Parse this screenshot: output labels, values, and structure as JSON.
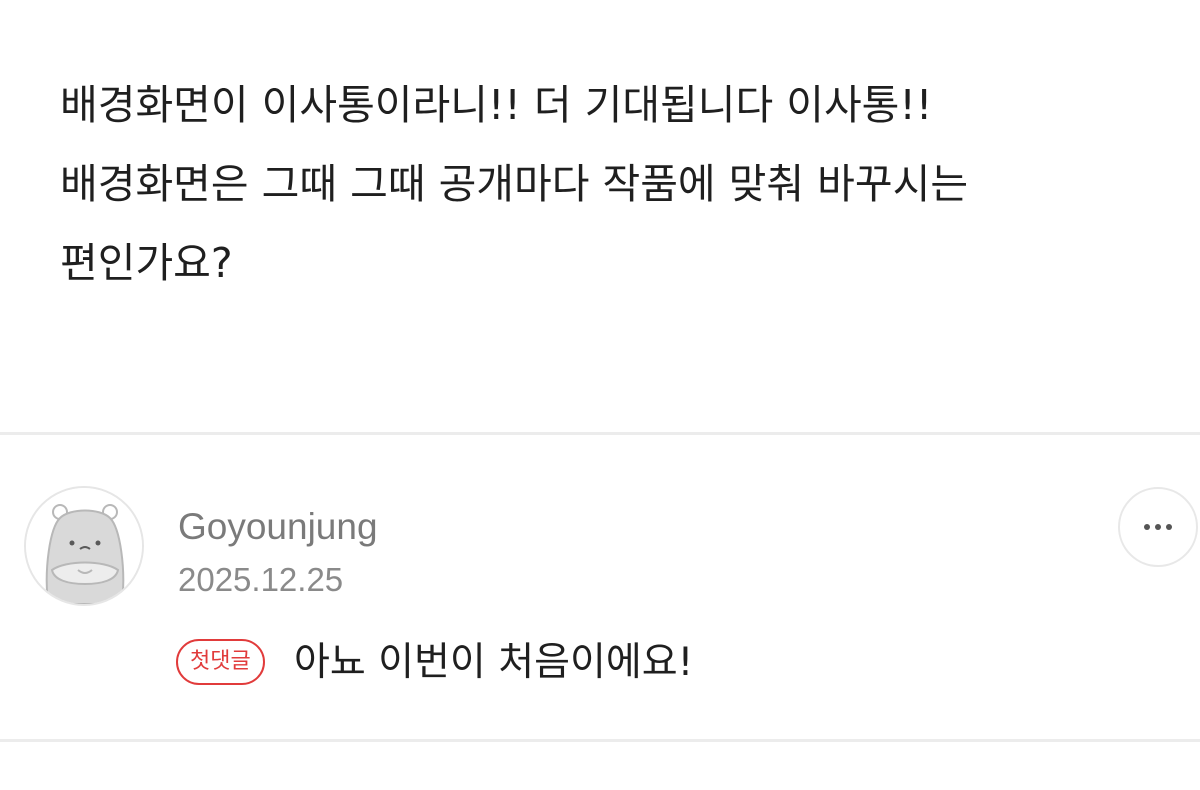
{
  "post": {
    "lines": [
      "배경화면이 이사통이라니!! 더 기대됩니다 이사통!!",
      "배경화면은 그때 그때 공개마다 작품에 맞춰 바꾸시는",
      "편인가요?"
    ]
  },
  "comment": {
    "author": "Goyounjung",
    "date": "2025.12.25",
    "badge": "첫댓글",
    "text": "아뇨 이번이 처음이에요!",
    "avatar_icon": "hamster-avatar-icon",
    "more_icon": "more-dots-icon"
  },
  "colors": {
    "text": "#1f1f1f",
    "muted": "#7a7a7a",
    "badge_red": "#e13b3b",
    "divider": "#ececec"
  }
}
